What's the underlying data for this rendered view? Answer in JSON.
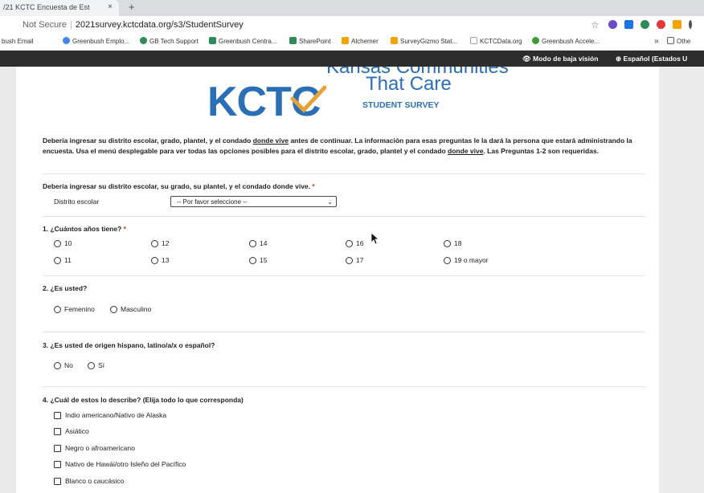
{
  "browser": {
    "tab_title": "/21 KCTC Encuesta de Est",
    "tab_close": "×",
    "new_tab": "+",
    "security": "Not Secure",
    "url": "2021survey.kctcdata.org/s3/StudentSurvey",
    "star": "☆",
    "bookmarks": [
      {
        "label": "bush Email",
        "color": "#ffffff"
      },
      {
        "label": "Greenbush Emplo...",
        "color": "#4285f4"
      },
      {
        "label": "GB Tech Support",
        "color": "#2e8b57"
      },
      {
        "label": "Greenbush Centra...",
        "color": "#2e8b57"
      },
      {
        "label": "SharePoint",
        "color": "#2e8b57"
      },
      {
        "label": "Alchemer",
        "color": "#f4a300"
      },
      {
        "label": "SurveyGizmo Stat...",
        "color": "#f4a300"
      },
      {
        "label": "KCTCData.org",
        "color": "#9aa0a6"
      },
      {
        "label": "Greenbush Accele...",
        "color": "#3a9d3a"
      }
    ],
    "more": "»",
    "other_bookmarks": "Othe"
  },
  "toolbar": {
    "low_vision": "Modo de baja visión",
    "language": "Español (Estados U"
  },
  "logo": {
    "kctc": "KCTC",
    "line1": "Kansas Communities",
    "line2": "That Care",
    "line3": "STUDENT SURVEY",
    "color": "#2b6fb6"
  },
  "instructions": {
    "p1": "Debería ingresar su distrito escolar, grado, plantel, y el condado ",
    "u1": "donde vive",
    "p2": " antes de continuar. La información para esas preguntas le la dará la persona que estará administrando la encuesta. Usa el menú desplegable para ver todas las opciones posibles para el distrito escolar, grado, plantel y el condado ",
    "u2": "donde vive",
    "p3": ". Las Preguntas 1-2 son requeridas."
  },
  "district_question": {
    "title": "Debería ingresar su distrito escolar, su grado, su plantel, y el condado donde vive.",
    "required_mark": "*",
    "field_label": "Distrito escolar",
    "select_value": "-- Por favor seleccione --",
    "chevron": "⌄"
  },
  "q1": {
    "title": "1. ¿Cuántos años tiene?",
    "required_mark": "*",
    "options": [
      "10",
      "12",
      "14",
      "16",
      "18",
      "11",
      "13",
      "15",
      "17",
      "19 o mayor"
    ]
  },
  "q2": {
    "title": "2. ¿Es usted?",
    "options": [
      "Femenino",
      "Masculino"
    ]
  },
  "q3": {
    "title": "3. ¿Es usted de origen hispano, latino/a/x o español?",
    "options": [
      "No",
      "Sí"
    ]
  },
  "q4": {
    "title": "4. ¿Cuál de estos lo describe? (Elija todo lo que corresponda)",
    "options": [
      "Indio americano/Nativo de Alaska",
      "Asiático",
      "Negro o afroamericano",
      "Nativo de Hawái/otro Isleño del Pacífico",
      "Blanco o caucásico"
    ]
  }
}
